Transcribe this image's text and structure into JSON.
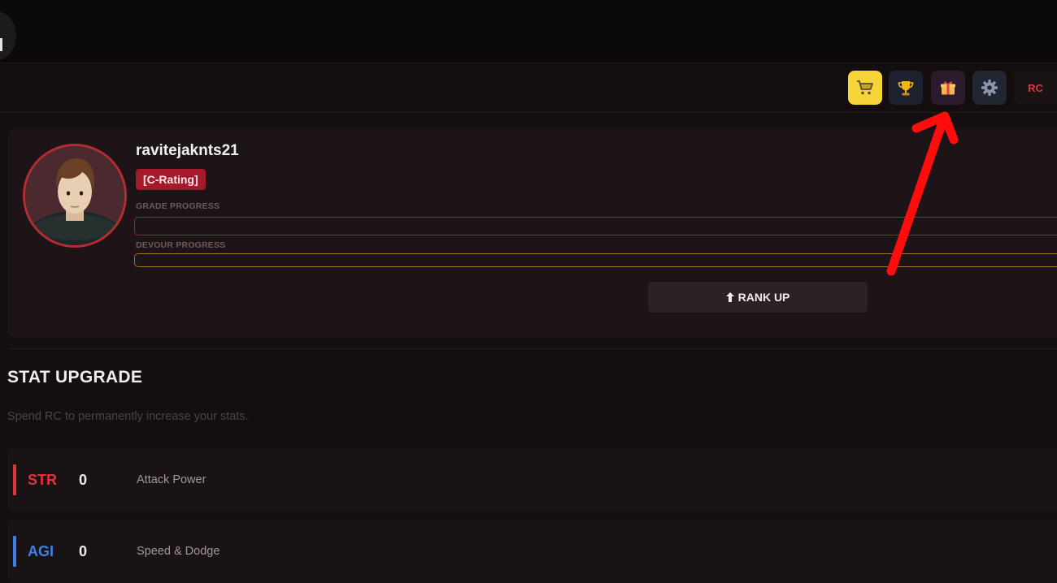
{
  "header": {
    "menu_icon": "menu-icon"
  },
  "nav": {
    "buttons": [
      {
        "id": "shop",
        "icon": "shopping-cart-icon",
        "color": "#f7d43a"
      },
      {
        "id": "leaderboard",
        "icon": "trophy-icon",
        "color": "#1e2130"
      },
      {
        "id": "rewards",
        "icon": "gift-icon",
        "color": "#2c1a2d"
      },
      {
        "id": "settings",
        "icon": "gear-icon",
        "color": "#222532"
      }
    ],
    "currency_label": "RC"
  },
  "profile": {
    "username": "ravitejaknts21",
    "rating": "[C-Rating]",
    "grade_progress_label": "GRADE PROGRESS",
    "grade_progress": 0,
    "devour_progress_label": "DEVOUR PROGRESS",
    "devour_progress": 0,
    "rank_up_label": "RANK UP",
    "rank_up_icon": "arrow-up-icon"
  },
  "stat_upgrade": {
    "title": "STAT UPGRADE",
    "subtitle": "Spend RC to permanently increase your stats.",
    "stats": [
      {
        "abbr": "STR",
        "value": "0",
        "description": "Attack Power",
        "color": "#e0343c"
      },
      {
        "abbr": "AGI",
        "value": "0",
        "description": "Speed & Dodge",
        "color": "#3f7fe6"
      }
    ]
  },
  "annotation": {
    "arrow_color": "#ff0d0d",
    "points_to": "rewards"
  }
}
